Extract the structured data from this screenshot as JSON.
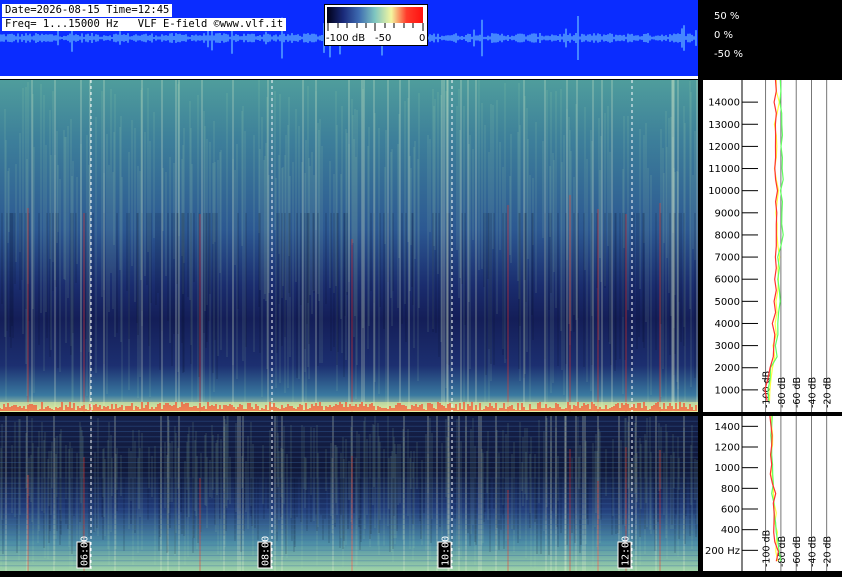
{
  "header": {
    "date_line": "Date=2026-08-15 Time=12:45",
    "freq_line": "Freq= 1...15000 Hz   VLF E-field ©www.vlf.it"
  },
  "colorbar": {
    "labels": [
      "-100 dB",
      "-50",
      "0"
    ],
    "stops": [
      "#000018",
      "#1a2a7a",
      "#3d6ab0",
      "#7fc6c0",
      "#f4f6a0",
      "#ff3a2a",
      "#ff1010"
    ]
  },
  "waveform": {
    "labels": [
      "50 %",
      "0 %",
      "-50 %"
    ],
    "background": "#0a2cff",
    "trace_color": "#7fe0ff"
  },
  "chart_data": [
    {
      "type": "heatmap",
      "name_hint": "upper spectrogram",
      "x_tick_labels": [
        "06:00",
        "08:00",
        "10:00",
        "12:00"
      ],
      "y_range_hz": [
        0,
        15000
      ],
      "y_ticks": [
        1000,
        2000,
        3000,
        4000,
        5000,
        6000,
        7000,
        8000,
        9000,
        10000,
        11000,
        12000,
        13000,
        14000
      ],
      "y_tick_labels": [
        "1000",
        "2000",
        "3000",
        "4000",
        "5000",
        "6000",
        "7000",
        "8000",
        "9000",
        "10000",
        "11000",
        "12000",
        "13000",
        "14000"
      ],
      "spectrum_x_labels": [
        "-100 dB",
        "-80 dB",
        "-60 dB",
        "-40 dB",
        "-20 dB"
      ],
      "spectrum_x_ticks": [
        -100,
        -80,
        -60,
        -40,
        -20
      ],
      "spectrum_x_range": [
        -110,
        0
      ],
      "spectrum_curves": [
        {
          "color": "#ffff40",
          "db": [
            -95,
            -93,
            -88,
            -86,
            -85,
            -84,
            -84,
            -84,
            -85,
            -85,
            -86,
            -86,
            -86,
            -85,
            -86
          ]
        },
        {
          "color": "#60ff60",
          "db": [
            -96,
            -94,
            -85,
            -84,
            -83,
            -82,
            -82,
            -80,
            -79,
            -78,
            -77,
            -78,
            -78,
            -79,
            -80
          ]
        },
        {
          "color": "#ff3030",
          "db": [
            -98,
            -97,
            -90,
            -88,
            -87,
            -86,
            -86,
            -86,
            -86,
            -87,
            -87,
            -87,
            -87,
            -86,
            -86
          ]
        }
      ]
    },
    {
      "type": "heatmap",
      "name_hint": "lower spectrogram",
      "x_tick_labels": [
        "06:00",
        "08:00",
        "10:00",
        "12:00"
      ],
      "y_range_hz": [
        0,
        1500
      ],
      "y_ticks": [
        200,
        400,
        600,
        800,
        1000,
        1200,
        1400
      ],
      "y_tick_labels": [
        "200 Hz",
        "400",
        "600",
        "800",
        "1000",
        "1200",
        "1400"
      ],
      "spectrum_x_labels": [
        "-100 dB",
        "-80 dB",
        "-60 dB",
        "-40 dB",
        "-20 dB"
      ],
      "spectrum_x_ticks": [
        -100,
        -80,
        -60,
        -40,
        -20
      ],
      "spectrum_x_range": [
        -110,
        0
      ],
      "spectrum_curves": [
        {
          "color": "#ffff40",
          "db": [
            -84,
            -86,
            -88,
            -89,
            -90,
            -91,
            -91,
            -92
          ]
        },
        {
          "color": "#60ff60",
          "db": [
            -80,
            -84,
            -87,
            -89,
            -90,
            -91,
            -92,
            -92
          ]
        },
        {
          "color": "#ff3030",
          "db": [
            -86,
            -88,
            -89,
            -90,
            -91,
            -92,
            -92,
            -93
          ]
        }
      ]
    }
  ]
}
